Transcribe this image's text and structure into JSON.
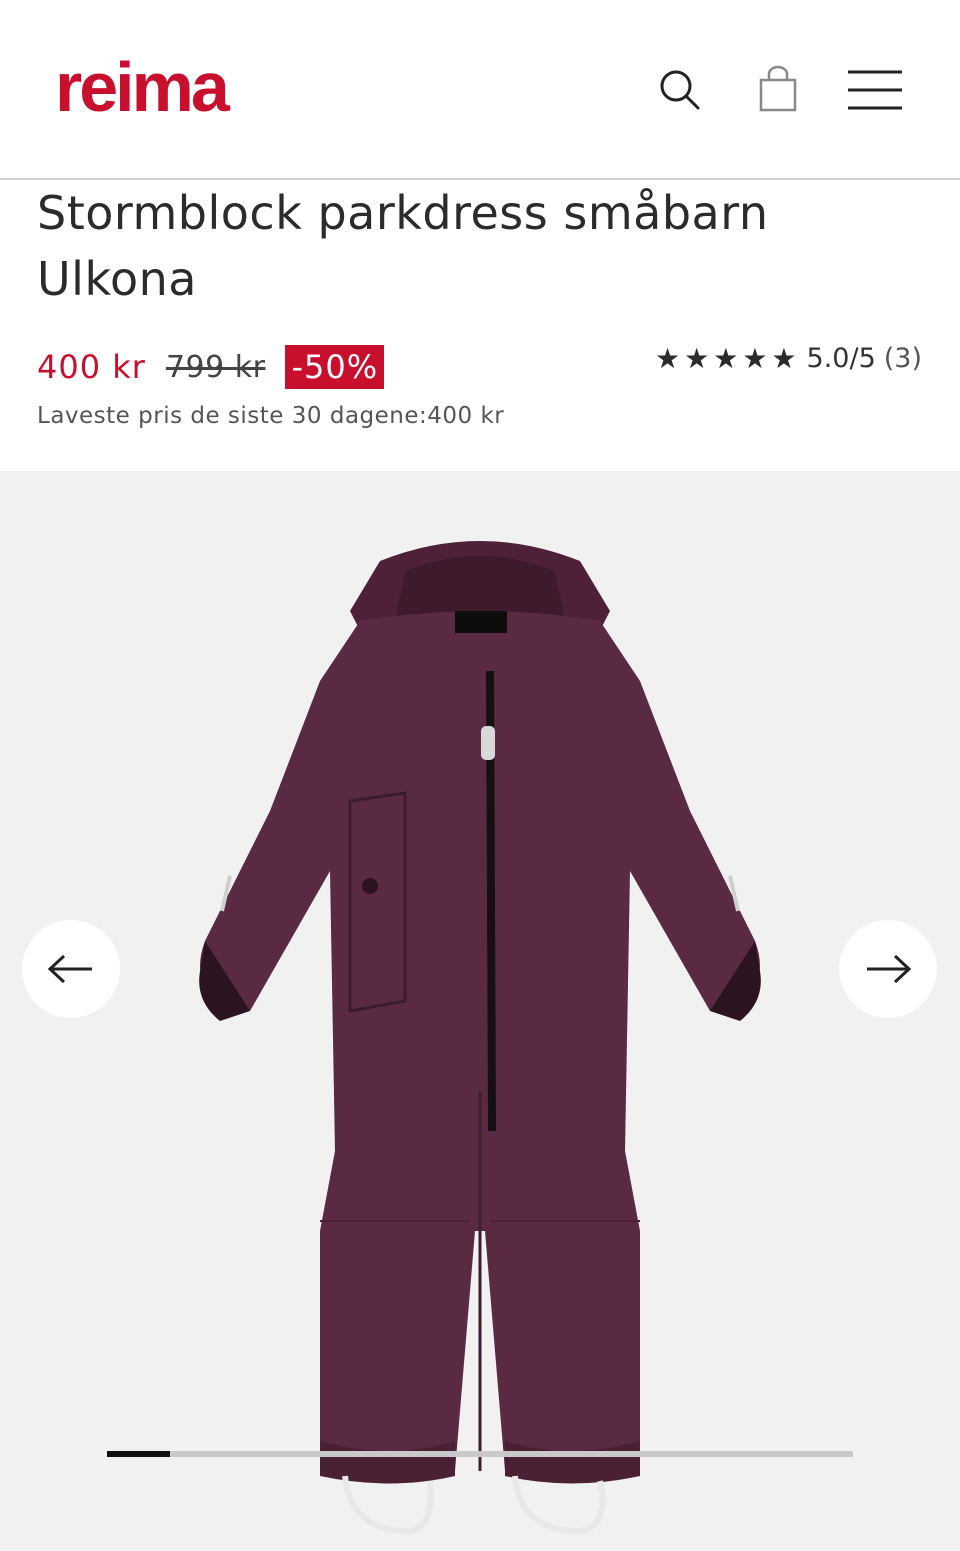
{
  "header": {
    "logo_text": "reima",
    "brand_color": "#c8102e",
    "icons": [
      "search-icon",
      "shopping-bag-icon",
      "menu-icon"
    ]
  },
  "product": {
    "title": "Stormblock parkdress småbarn Ulkona",
    "price_current": "400 kr",
    "price_original": "799 kr",
    "discount_badge": "-50%",
    "lowest_price_note": "Laveste pris de siste 30 dagene:400 kr",
    "rating": {
      "stars": "★★★★★",
      "score_text": "5.0/5",
      "count_text": "(3)",
      "value": 5.0
    }
  },
  "gallery": {
    "image_alt": "purple toddler snowsuit",
    "prev_icon": "arrow-left-icon",
    "next_icon": "arrow-right-icon",
    "progress_fraction": 0.084,
    "suit_color": "#5a2a43"
  }
}
